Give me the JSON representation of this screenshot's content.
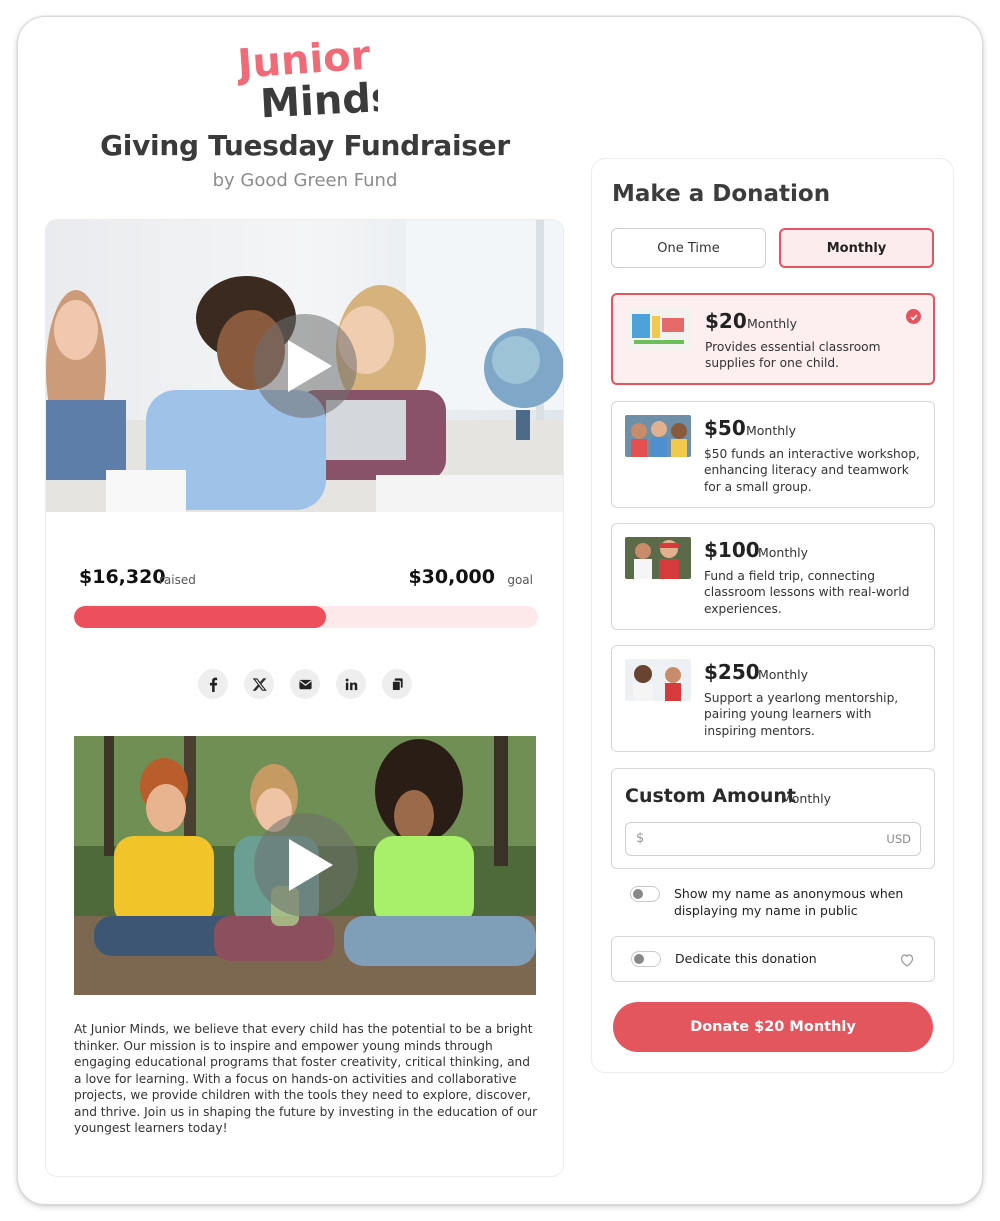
{
  "brand": {
    "logo_line1": "Junior",
    "logo_line2": "Minds",
    "accent": "#e5545f",
    "logo_pink": "#ef6b78",
    "logo_dark": "#3b3b3b"
  },
  "campaign": {
    "title": "Giving Tuesday Fundraiser",
    "subtitle": "by Good Green Fund",
    "raised_amount": "$16,320",
    "raised_label": "raised",
    "goal_amount": "$30,000",
    "goal_label": "goal",
    "progress_fraction": 0.544,
    "share_icons": [
      "facebook-icon",
      "x-icon",
      "email-icon",
      "linkedin-icon",
      "copy-link-icon"
    ],
    "description": "At Junior Minds, we believe that every child has the potential to be a bright thinker. Our mission is to inspire and empower young minds through engaging educational programs that foster creativity, critical thinking, and a love for learning. With a focus on hands-on activities and collaborative projects, we provide children with the tools they need to explore, discover, and thrive. Join us in shaping the future by investing in the education of our youngest learners today!"
  },
  "donation": {
    "title": "Make a Donation",
    "frequency": {
      "one_time": "One Time",
      "monthly": "Monthly",
      "selected": "Monthly"
    },
    "tiers": [
      {
        "amount": "$20",
        "frequency": "Monthly",
        "description": "Provides essential classroom supplies for one child.",
        "selected": true
      },
      {
        "amount": "$50",
        "frequency": "Monthly",
        "description": "$50 funds an interactive workshop, enhancing literacy and teamwork for a small group.",
        "selected": false
      },
      {
        "amount": "$100",
        "frequency": "Monthly",
        "description": "Fund a field trip, connecting classroom lessons with real-world experiences.",
        "selected": false
      },
      {
        "amount": "$250",
        "frequency": "Monthly",
        "description": "Support a yearlong mentorship, pairing young learners with inspiring mentors.",
        "selected": false
      }
    ],
    "custom": {
      "title": "Custom Amount",
      "frequency": "Monthly",
      "currency_symbol": "$",
      "currency_code": "USD",
      "value": ""
    },
    "anonymous_label": "Show my name as anonymous when displaying my name in public",
    "anonymous_on": false,
    "dedicate_label": "Dedicate this donation",
    "dedicate_on": false,
    "donate_button": "Donate $20 Monthly"
  }
}
